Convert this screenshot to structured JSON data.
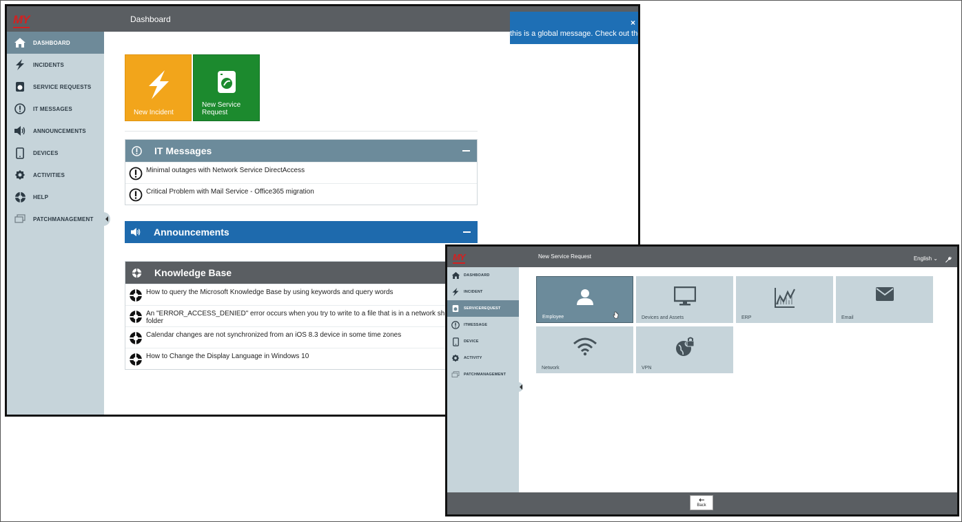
{
  "colors": {
    "accent_orange": "#f2a51b",
    "accent_green": "#1c8a2e",
    "header_gray": "#5a5e62",
    "sidebar": "#c6d4da",
    "blue": "#1e6aad",
    "brand_red": "#d42020"
  },
  "dashboard": {
    "logo": "MY",
    "title": "Dashboard",
    "sidebar": [
      {
        "label": "DASHBOARD",
        "icon": "home-icon"
      },
      {
        "label": "INCIDENTS",
        "icon": "lightning-icon"
      },
      {
        "label": "SERVICE REQUESTS",
        "icon": "service-request-icon"
      },
      {
        "label": "IT MESSAGES",
        "icon": "exclamation-icon"
      },
      {
        "label": "ANNOUNCEMENTS",
        "icon": "speaker-icon"
      },
      {
        "label": "DEVICES",
        "icon": "tablet-icon"
      },
      {
        "label": "ACTIVITIES",
        "icon": "gear-icon"
      },
      {
        "label": "HELP",
        "icon": "lifebuoy-icon"
      },
      {
        "label": "PATCHMANAGEMENT",
        "icon": "windows-icon"
      }
    ],
    "toast": {
      "close": "×",
      "message": "this is a global message. Check out the m"
    },
    "tiles": {
      "incident": "New Incident",
      "service_request_line1": "New Service",
      "service_request_line2": "Request"
    },
    "it_messages": {
      "title": "IT Messages",
      "items": [
        "Minimal outages with Network Service DirectAccess",
        "Critical Problem with Mail Service - Office365 migration"
      ]
    },
    "announcements": {
      "title": "Announcements"
    },
    "knowledge_base": {
      "title": "Knowledge Base",
      "items": [
        {
          "line1": "How to query the Microsoft Knowledge Base by using keywords and query words",
          "line2": ""
        },
        {
          "line1": "An \"ERROR_ACCESS_DENIED\" error occurs when you try to write to a file that is in a network sh",
          "line2": "folder"
        },
        {
          "line1": "Calendar changes are not synchronized from an iOS 8.3 device in some time zones",
          "line2": ""
        },
        {
          "line1": "How to Change the Display Language in Windows 10",
          "line2": ""
        }
      ]
    }
  },
  "service_request": {
    "logo": "MY",
    "title": "New Service Request",
    "language": "English ⌄",
    "sidebar": [
      {
        "label": "DASHBOARD",
        "icon": "home-icon"
      },
      {
        "label": "INCIDENT",
        "icon": "lightning-icon"
      },
      {
        "label": "SERVICEREQUEST",
        "icon": "service-request-icon"
      },
      {
        "label": "ITMESSAGE",
        "icon": "exclamation-icon"
      },
      {
        "label": "DEVICE",
        "icon": "tablet-icon"
      },
      {
        "label": "ACTIVITY",
        "icon": "gear-icon"
      },
      {
        "label": "PATCHMANAGEMENT",
        "icon": "windows-icon"
      }
    ],
    "tiles": [
      "Employee",
      "Devices and Assets",
      "ERP",
      "Email",
      "Network",
      "VPN"
    ],
    "back": "Back"
  }
}
